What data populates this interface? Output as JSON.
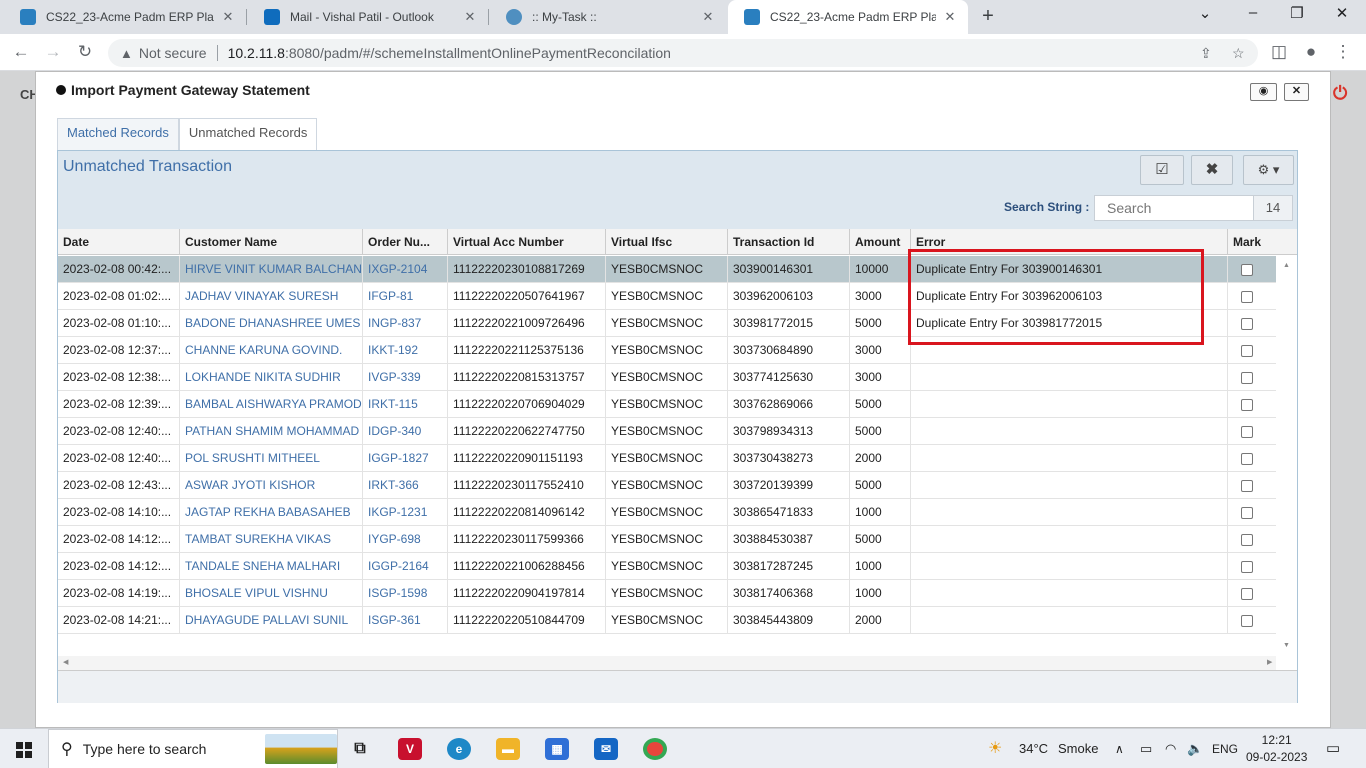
{
  "browser": {
    "tabs": [
      {
        "title": "CS22_23-Acme Padm ERP Platfor",
        "active": false
      },
      {
        "title": "Mail - Vishal Patil - Outlook",
        "active": false
      },
      {
        "title": ":: My-Task ::",
        "active": false
      },
      {
        "title": "CS22_23-Acme Padm ERP Platfor",
        "active": true
      }
    ],
    "security": "Not secure",
    "url_host": "10.2.11.8",
    "url_rest": ":8080/padm/#/schemeInstallmentOnlinePaymentReconcilation"
  },
  "background_app": {
    "header_text": "CH"
  },
  "modal": {
    "title": "Import Payment Gateway Statement",
    "tabs": [
      "Matched Records",
      "Unmatched Records"
    ],
    "active_tab": "Unmatched Records",
    "panel_title": "Unmatched Transaction",
    "search_label": "Search String :",
    "search_placeholder": "Search",
    "record_count": "14",
    "columns": [
      "Date",
      "Customer Name",
      "Order Nu...",
      "Virtual Acc Number",
      "Virtual Ifsc",
      "Transaction Id",
      "Amount",
      "Error",
      "Mark"
    ],
    "rows": [
      {
        "date": "2023-02-08 00:42:...",
        "customer": "HIRVE VINIT KUMAR BALCHAN",
        "order": "IXGP-2104",
        "vacc": "11122220230108817269",
        "ifsc": "YESB0CMSNOC",
        "txn": "303900146301",
        "amount": "10000",
        "error": "Duplicate Entry For 303900146301"
      },
      {
        "date": "2023-02-08 01:02:...",
        "customer": "JADHAV VINAYAK SURESH",
        "order": "IFGP-81",
        "vacc": "11122220220507641967",
        "ifsc": "YESB0CMSNOC",
        "txn": "303962006103",
        "amount": "3000",
        "error": "Duplicate Entry For 303962006103"
      },
      {
        "date": "2023-02-08 01:10:...",
        "customer": "BADONE DHANASHREE UMES",
        "order": "INGP-837",
        "vacc": "11122220221009726496",
        "ifsc": "YESB0CMSNOC",
        "txn": "303981772015",
        "amount": "5000",
        "error": "Duplicate Entry For 303981772015"
      },
      {
        "date": "2023-02-08 12:37:...",
        "customer": "CHANNE KARUNA GOVIND.",
        "order": "IKKT-192",
        "vacc": "11122220221125375136",
        "ifsc": "YESB0CMSNOC",
        "txn": "303730684890",
        "amount": "3000",
        "error": ""
      },
      {
        "date": "2023-02-08 12:38:...",
        "customer": "LOKHANDE NIKITA SUDHIR",
        "order": "IVGP-339",
        "vacc": "11122220220815313757",
        "ifsc": "YESB0CMSNOC",
        "txn": "303774125630",
        "amount": "3000",
        "error": ""
      },
      {
        "date": "2023-02-08 12:39:...",
        "customer": "BAMBAL AISHWARYA PRAMOD",
        "order": "IRKT-115",
        "vacc": "11122220220706904029",
        "ifsc": "YESB0CMSNOC",
        "txn": "303762869066",
        "amount": "5000",
        "error": ""
      },
      {
        "date": "2023-02-08 12:40:...",
        "customer": "PATHAN SHAMIM MOHAMMAD",
        "order": "IDGP-340",
        "vacc": "11122220220622747750",
        "ifsc": "YESB0CMSNOC",
        "txn": "303798934313",
        "amount": "5000",
        "error": ""
      },
      {
        "date": "2023-02-08 12:40:...",
        "customer": "POL SRUSHTI MITHEEL",
        "order": "IGGP-1827",
        "vacc": "11122220220901151193",
        "ifsc": "YESB0CMSNOC",
        "txn": "303730438273",
        "amount": "2000",
        "error": ""
      },
      {
        "date": "2023-02-08 12:43:...",
        "customer": "ASWAR JYOTI KISHOR",
        "order": "IRKT-366",
        "vacc": "11122220230117552410",
        "ifsc": "YESB0CMSNOC",
        "txn": "303720139399",
        "amount": "5000",
        "error": ""
      },
      {
        "date": "2023-02-08 14:10:...",
        "customer": "JAGTAP REKHA BABASAHEB",
        "order": "IKGP-1231",
        "vacc": "11122220220814096142",
        "ifsc": "YESB0CMSNOC",
        "txn": "303865471833",
        "amount": "1000",
        "error": ""
      },
      {
        "date": "2023-02-08 14:12:...",
        "customer": "TAMBAT SUREKHA VIKAS",
        "order": "IYGP-698",
        "vacc": "11122220230117599366",
        "ifsc": "YESB0CMSNOC",
        "txn": "303884530387",
        "amount": "5000",
        "error": ""
      },
      {
        "date": "2023-02-08 14:12:...",
        "customer": "TANDALE SNEHA MALHARI",
        "order": "IGGP-2164",
        "vacc": "11122220221006288456",
        "ifsc": "YESB0CMSNOC",
        "txn": "303817287245",
        "amount": "1000",
        "error": ""
      },
      {
        "date": "2023-02-08 14:19:...",
        "customer": "BHOSALE VIPUL VISHNU",
        "order": "ISGP-1598",
        "vacc": "11122220220904197814",
        "ifsc": "YESB0CMSNOC",
        "txn": "303817406368",
        "amount": "1000",
        "error": ""
      },
      {
        "date": "2023-02-08 14:21:...",
        "customer": "DHAYAGUDE PALLAVI SUNIL",
        "order": "ISGP-361",
        "vacc": "11122220220510844709",
        "ifsc": "YESB0CMSNOC",
        "txn": "303845443809",
        "amount": "2000",
        "error": ""
      }
    ]
  },
  "taskbar": {
    "search_placeholder": "Type here to search",
    "weather_temp": "34°C",
    "weather_desc": "Smoke",
    "language": "ENG",
    "time": "12:21",
    "date": "09-02-2023"
  },
  "colors": {
    "highlight_box": "#d9151e",
    "link_blue": "#3f6fa8",
    "selected_row": "#b8c7cc"
  }
}
